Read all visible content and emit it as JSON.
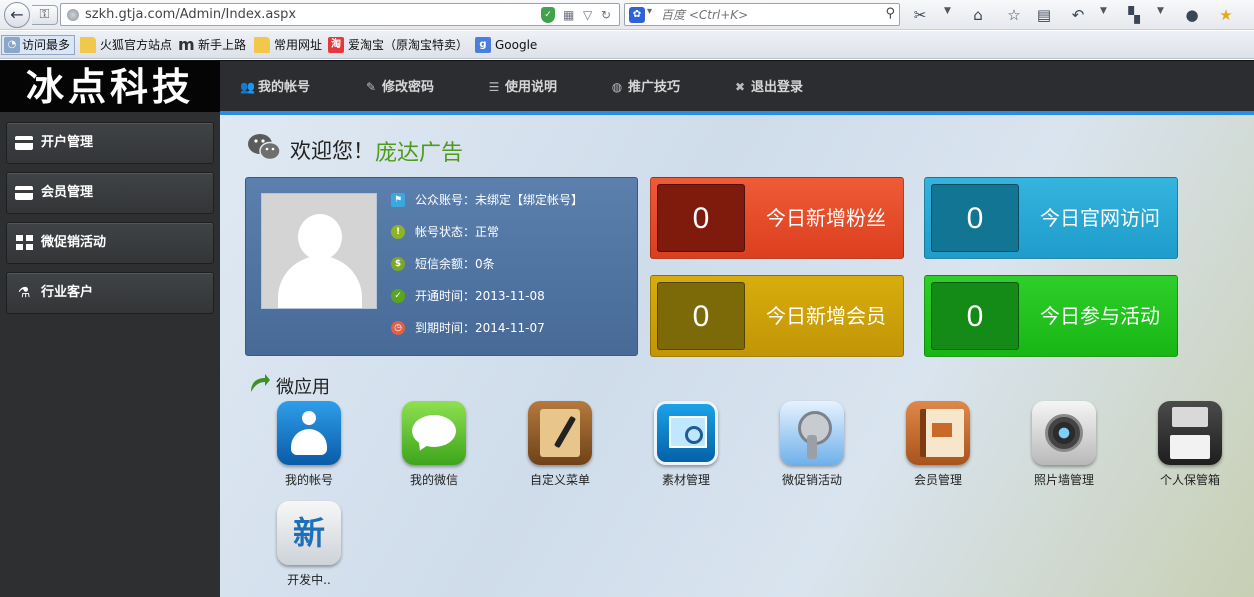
{
  "browser": {
    "url": "szkh.gtja.com/Admin/Index.aspx",
    "search_placeholder": "百度 <Ctrl+K>",
    "bookmarks": [
      {
        "label": "访问最多",
        "icon": "most-visited-icon"
      },
      {
        "label": "火狐官方站点",
        "icon": "folder-icon"
      },
      {
        "label": "新手上路",
        "icon": "m-logo-icon"
      },
      {
        "label": "常用网址",
        "icon": "folder-icon"
      },
      {
        "label": "爱淘宝（原淘宝特卖）",
        "icon": "taobao-icon"
      },
      {
        "label": "Google",
        "icon": "google-icon"
      }
    ]
  },
  "header": {
    "logo": "冰点科技",
    "nav": [
      {
        "label": "我的帐号",
        "icon": "users-icon"
      },
      {
        "label": "修改密码",
        "icon": "edit-icon"
      },
      {
        "label": "使用说明",
        "icon": "list-icon"
      },
      {
        "label": "推广技巧",
        "icon": "globe-icon"
      },
      {
        "label": "退出登录",
        "icon": "close-icon"
      }
    ]
  },
  "sidebar": {
    "items": [
      {
        "label": "开户管理",
        "icon": "card-icon"
      },
      {
        "label": "会员管理",
        "icon": "card-icon"
      },
      {
        "label": "微促销活动",
        "icon": "grid-icon"
      },
      {
        "label": "行业客户",
        "icon": "flask-icon"
      }
    ]
  },
  "welcome": {
    "greeting": "欢迎您！",
    "name": "庞达广告"
  },
  "profile": {
    "rows": [
      {
        "text": "公众账号：未绑定【绑定帐号】",
        "icon": "flag-icon",
        "color": "#3aa7e0"
      },
      {
        "text": "帐号状态：正常",
        "icon": "alert-icon",
        "color": "#8fb326"
      },
      {
        "text": "短信余额：0条",
        "icon": "money-bag-icon",
        "color": "#7ba62a"
      },
      {
        "text": "开通时间：2013-11-08",
        "icon": "check-icon",
        "color": "#5ba51c"
      },
      {
        "text": "到期时间：2014-11-07",
        "icon": "clock-icon",
        "color": "#e0604a"
      }
    ]
  },
  "stats": [
    {
      "value": "0",
      "label": "今日新增粉丝",
      "theme": "red"
    },
    {
      "value": "0",
      "label": "今日官网访问",
      "theme": "blue"
    },
    {
      "value": "0",
      "label": "今日新增会员",
      "theme": "yellow"
    },
    {
      "value": "0",
      "label": "今日参与活动",
      "theme": "green"
    }
  ],
  "apps": {
    "title": "微应用",
    "items": [
      {
        "label": "我的帐号",
        "icon": "account-app-icon"
      },
      {
        "label": "我的微信",
        "icon": "wechat-app-icon"
      },
      {
        "label": "自定义菜单",
        "icon": "custom-menu-app-icon"
      },
      {
        "label": "素材管理",
        "icon": "media-app-icon"
      },
      {
        "label": "微促销活动",
        "icon": "promo-app-icon"
      },
      {
        "label": "会员管理",
        "icon": "member-app-icon"
      },
      {
        "label": "照片墙管理",
        "icon": "photo-wall-app-icon"
      },
      {
        "label": "个人保管箱",
        "icon": "safe-box-app-icon"
      },
      {
        "label": "开发中..",
        "icon": "new-app-icon",
        "badge": "新"
      }
    ]
  }
}
